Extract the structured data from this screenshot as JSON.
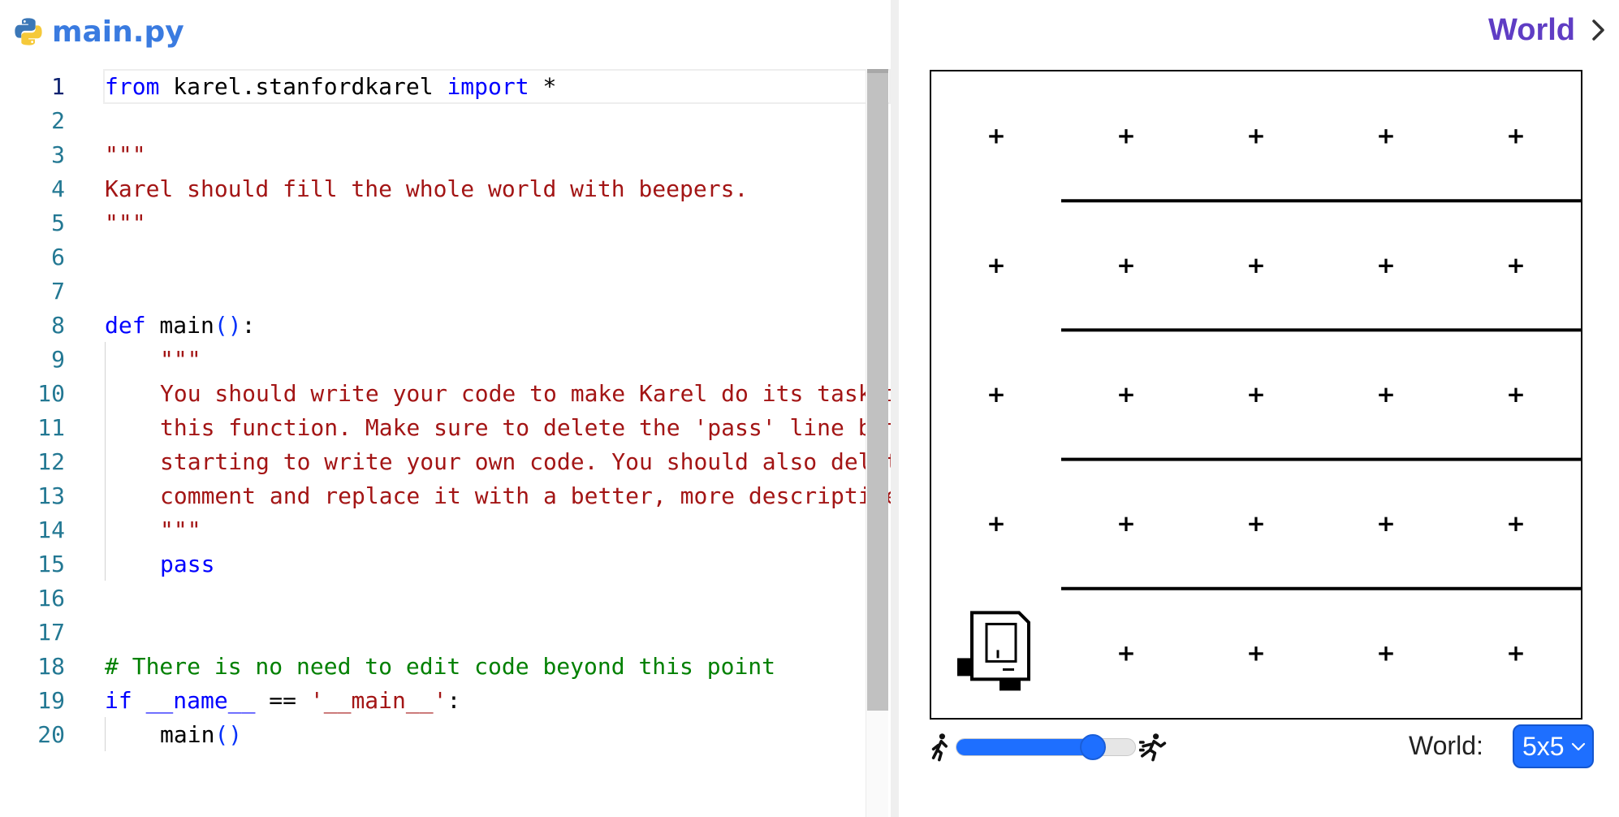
{
  "editor": {
    "file_name": "main.py",
    "active_line": 1,
    "lines": [
      {
        "n": "1"
      },
      {
        "n": "2"
      },
      {
        "n": "3"
      },
      {
        "n": "4"
      },
      {
        "n": "5"
      },
      {
        "n": "6"
      },
      {
        "n": "7"
      },
      {
        "n": "8"
      },
      {
        "n": "9"
      },
      {
        "n": "10"
      },
      {
        "n": "11"
      },
      {
        "n": "12"
      },
      {
        "n": "13"
      },
      {
        "n": "14"
      },
      {
        "n": "15"
      },
      {
        "n": "16"
      },
      {
        "n": "17"
      },
      {
        "n": "18"
      },
      {
        "n": "19"
      },
      {
        "n": "20"
      }
    ],
    "code": {
      "l1_from": "from",
      "l1_module": " karel.stanfordkarel ",
      "l1_import": "import",
      "l1_star": " *",
      "l3": "\"\"\"",
      "l4": "Karel should fill the whole world with beepers.",
      "l5": "\"\"\"",
      "l8_def": "def",
      "l8_name": " main",
      "l8_paren": "()",
      "l8_colon": ":",
      "l9": "\"\"\"",
      "l10": "You should write your code to make Karel do its task in",
      "l11": "this function. Make sure to delete the 'pass' line before",
      "l12": "starting to write your own code. You should also delete this",
      "l13": "comment and replace it with a better, more descriptive one.",
      "l14": "\"\"\"",
      "l15": "pass",
      "l18": "# There is no need to edit code beyond this point",
      "l19_if": "if",
      "l19_name": " __name__ ",
      "l19_eq": "== ",
      "l19_str": "'__main__'",
      "l19_colon": ":",
      "l20_call": "main",
      "l20_paren": "()"
    }
  },
  "world": {
    "title": "World",
    "cols": 5,
    "rows": 5,
    "corner_marker": "+",
    "karel": {
      "row": 1,
      "col": 1,
      "facing": "east"
    },
    "walls": [
      {
        "between_rows": [
          5,
          4
        ],
        "from_col": 2,
        "to_col": 5
      },
      {
        "between_rows": [
          4,
          3
        ],
        "from_col": 2,
        "to_col": 5
      },
      {
        "between_rows": [
          3,
          2
        ],
        "from_col": 2,
        "to_col": 5
      },
      {
        "between_rows": [
          2,
          1
        ],
        "from_col": 2,
        "to_col": 5
      }
    ],
    "speed": 0.76,
    "select_label": "World:",
    "selected_world": "5x5"
  },
  "colors": {
    "file_name": "#3a7be0",
    "world_title": "#5f3dc4",
    "keyword": "#0000ff",
    "string": "#a31515",
    "comment": "#008000",
    "accent": "#1e6fff"
  },
  "icons": {
    "file": "python-icon",
    "world_toggle": "chevron-right-icon",
    "slow": "walk-icon",
    "fast": "run-icon",
    "select": "chevron-down-icon"
  }
}
